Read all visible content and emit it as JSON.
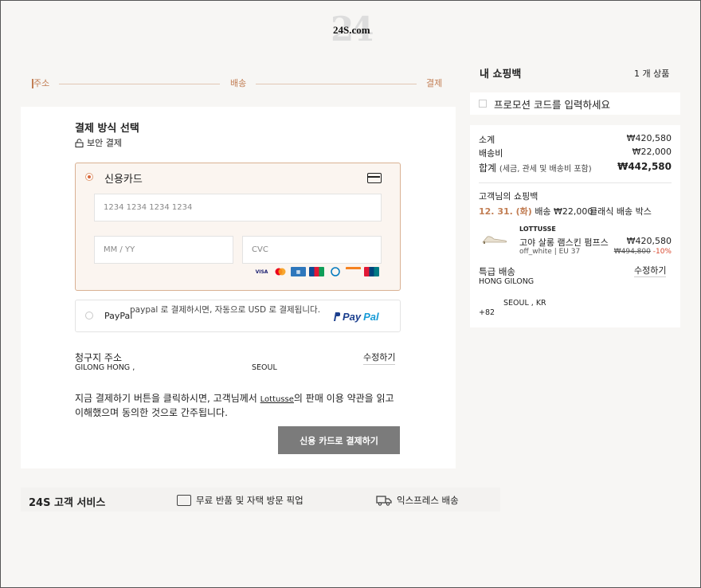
{
  "logo": {
    "text": "24S.com"
  },
  "steps": [
    "주소",
    "배송",
    "결제"
  ],
  "payment": {
    "title": "결제 방식 선택",
    "secure": "보안 결제",
    "credit_card": {
      "label": "신용카드",
      "card_number_placeholder": "1234 1234 1234 1234",
      "expiry_placeholder": "MM / YY",
      "cvc_placeholder": "CVC",
      "brands": [
        "VISA",
        "MC",
        "AMEX",
        "JCB",
        "DC",
        "DISC",
        "UP"
      ]
    },
    "paypal": {
      "label": "PayPal",
      "note": "paypal 로 결제하시면, 자동으로 USD 로 결제됩니다.",
      "logo_a": "Pay",
      "logo_b": "Pal"
    }
  },
  "billing": {
    "title": "청구지 주소",
    "edit": "수정하기",
    "name": "GILONG HONG ,",
    "city": "SEOUL"
  },
  "terms": {
    "before": "지금 결제하기 버튼을 클릭하시면, 고객님께서 ",
    "link": "Lottusse",
    "after": "의 판매 이용 약관을 읽고 이해했으며 동의한 것으로 간주됩니다."
  },
  "pay_button": "신용 카드로 결제하기",
  "service": {
    "title": "24S 고객 서비스",
    "items": [
      "무료 반품 및 자택 방문 픽업",
      "익스프레스 배송"
    ]
  },
  "cart": {
    "title": "내 쇼핑백",
    "count": "1 개 상품",
    "promo": "프로모션 코드를 입력하세요",
    "subtotal_label": "소계",
    "subtotal": "₩420,580",
    "shipping_label": "배송비",
    "shipping": "₩22,000",
    "total_label": "합계",
    "total_note": "(세금, 관세 및 배송비 포함)",
    "total": "₩442,580",
    "bag_label": "고객님의 쇼핑백",
    "delivery_date": "12. 31. (화)",
    "delivery_fee": "배송 ₩22,000",
    "delivery_type": "클래식 배송 박스",
    "item": {
      "brand": "LOTTUSSE",
      "name": "고야 살롱 램스킨 펌프스",
      "color": "off_white",
      "size": "EU 37",
      "price": "₩420,580",
      "old_price": "₩494,800",
      "discount": "-10%"
    },
    "express_label": "특급 배송",
    "express_edit": "수정하기",
    "express_name": "HONG GILONG",
    "express_city": "SEOUL , KR",
    "express_phone": "+82"
  }
}
